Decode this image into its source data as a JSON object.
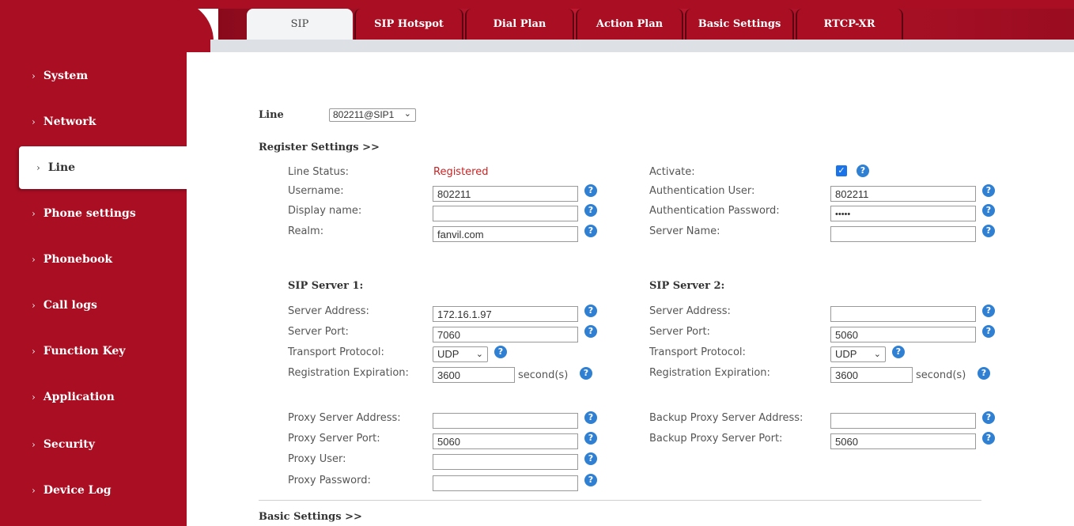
{
  "sidebar": {
    "items": [
      {
        "label": "System"
      },
      {
        "label": "Network"
      },
      {
        "label": "Line"
      },
      {
        "label": "Phone settings"
      },
      {
        "label": "Phonebook"
      },
      {
        "label": "Call logs"
      },
      {
        "label": "Function Key"
      },
      {
        "label": "Application"
      },
      {
        "label": "Security"
      },
      {
        "label": "Device Log"
      }
    ],
    "active_item": "Line"
  },
  "tabs": [
    {
      "label": "SIP"
    },
    {
      "label": "SIP Hotspot"
    },
    {
      "label": "Dial Plan"
    },
    {
      "label": "Action Plan"
    },
    {
      "label": "Basic Settings"
    },
    {
      "label": "RTCP-XR"
    }
  ],
  "active_tab": "SIP",
  "line": {
    "label": "Line",
    "selected": "802211@SIP1"
  },
  "register_settings": {
    "title": "Register Settings >>",
    "line_status_label": "Line Status:",
    "line_status_value": "Registered",
    "activate_label": "Activate:",
    "activate_checked": true,
    "username_label": "Username:",
    "username_value": "802211",
    "auth_user_label": "Authentication User:",
    "auth_user_value": "802211",
    "display_name_label": "Display name:",
    "display_name_value": "",
    "auth_password_label": "Authentication Password:",
    "auth_password_value": "•••••",
    "realm_label": "Realm:",
    "realm_value": "fanvil.com",
    "server_name_label": "Server Name:",
    "server_name_value": ""
  },
  "sip_server_1": {
    "title": "SIP Server 1:",
    "address_label": "Server Address:",
    "address_value": "172.16.1.97",
    "port_label": "Server Port:",
    "port_value": "7060",
    "transport_label": "Transport Protocol:",
    "transport_value": "UDP",
    "expiration_label": "Registration Expiration:",
    "expiration_value": "3600",
    "expiration_unit": "second(s)"
  },
  "sip_server_2": {
    "title": "SIP Server 2:",
    "address_label": "Server Address:",
    "address_value": "",
    "port_label": "Server Port:",
    "port_value": "5060",
    "transport_label": "Transport Protocol:",
    "transport_value": "UDP",
    "expiration_label": "Registration Expiration:",
    "expiration_value": "3600",
    "expiration_unit": "second(s)"
  },
  "proxy": {
    "address_label": "Proxy Server Address:",
    "address_value": "",
    "port_label": "Proxy Server Port:",
    "port_value": "5060",
    "user_label": "Proxy User:",
    "user_value": "",
    "password_label": "Proxy Password:",
    "password_value": "",
    "backup_address_label": "Backup Proxy Server Address:",
    "backup_address_value": "",
    "backup_port_label": "Backup Proxy Server Port:",
    "backup_port_value": "5060"
  },
  "basic_settings": {
    "title": "Basic Settings >>"
  },
  "icons": {
    "help": "help-icon",
    "nav_chevron": "chevron-right-icon",
    "dropdown": "chevron-down-icon",
    "checkbox": "checkmark-icon"
  },
  "colors": {
    "brand_red": "#a90e23",
    "help_blue": "#2f7fd3",
    "status_red": "#cc2222",
    "checkbox_blue": "#1a73e8"
  }
}
